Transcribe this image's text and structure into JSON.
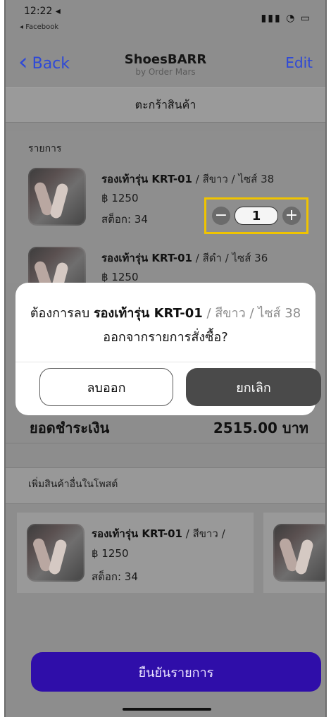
{
  "status": {
    "time": "12:22 ◂",
    "back_app": "◂ Facebook",
    "icons": "▮▮▮ ◔ ▭"
  },
  "nav": {
    "back": "Back",
    "title": "ShoesBARR",
    "subtitle": "by Order Mars",
    "edit": "Edit"
  },
  "cart": {
    "header": "ตะกร้าสินค้า",
    "list_label": "รายการ",
    "items": [
      {
        "name": "รองเท้ารุ่น KRT-01",
        "variant": "/ สีขาว / ไซส์ 38",
        "price": "฿ 1250",
        "stock": "สต็อก: 34",
        "qty": "1"
      },
      {
        "name": "รองเท้ารุ่น KRT-01",
        "variant": "/ สีดำ / ไซส์ 36",
        "price": "฿ 1250",
        "stock": "",
        "qty": ""
      }
    ],
    "total_label": "ยอดชำระเงิน",
    "total_value": "2515.00 บาท"
  },
  "modal": {
    "line1_prefix": "ต้องการลบ ",
    "line1_item": "รองเท้ารุ่น KRT-01",
    "line1_variant": "/ สีขาว / ไซส์ 38",
    "line2": "ออกจากรายการสั่งซื้อ?",
    "delete": "ลบออก",
    "cancel": "ยกเลิก"
  },
  "more": {
    "label": "เพิ่มสินค้าอื่นในโพสต์",
    "card": {
      "name": "รองเท้ารุ่น KRT-01",
      "variant": "/ สีขาว /",
      "price": "฿ 1250",
      "stock": "สต็อก: 34"
    }
  },
  "confirm": "ยืนยันรายการ",
  "colors": {
    "link_blue": "#2e49d7",
    "highlight_yellow": "#f0c400",
    "confirm_purple": "#2f0ea9",
    "cancel_dark": "#4a4a4a"
  }
}
